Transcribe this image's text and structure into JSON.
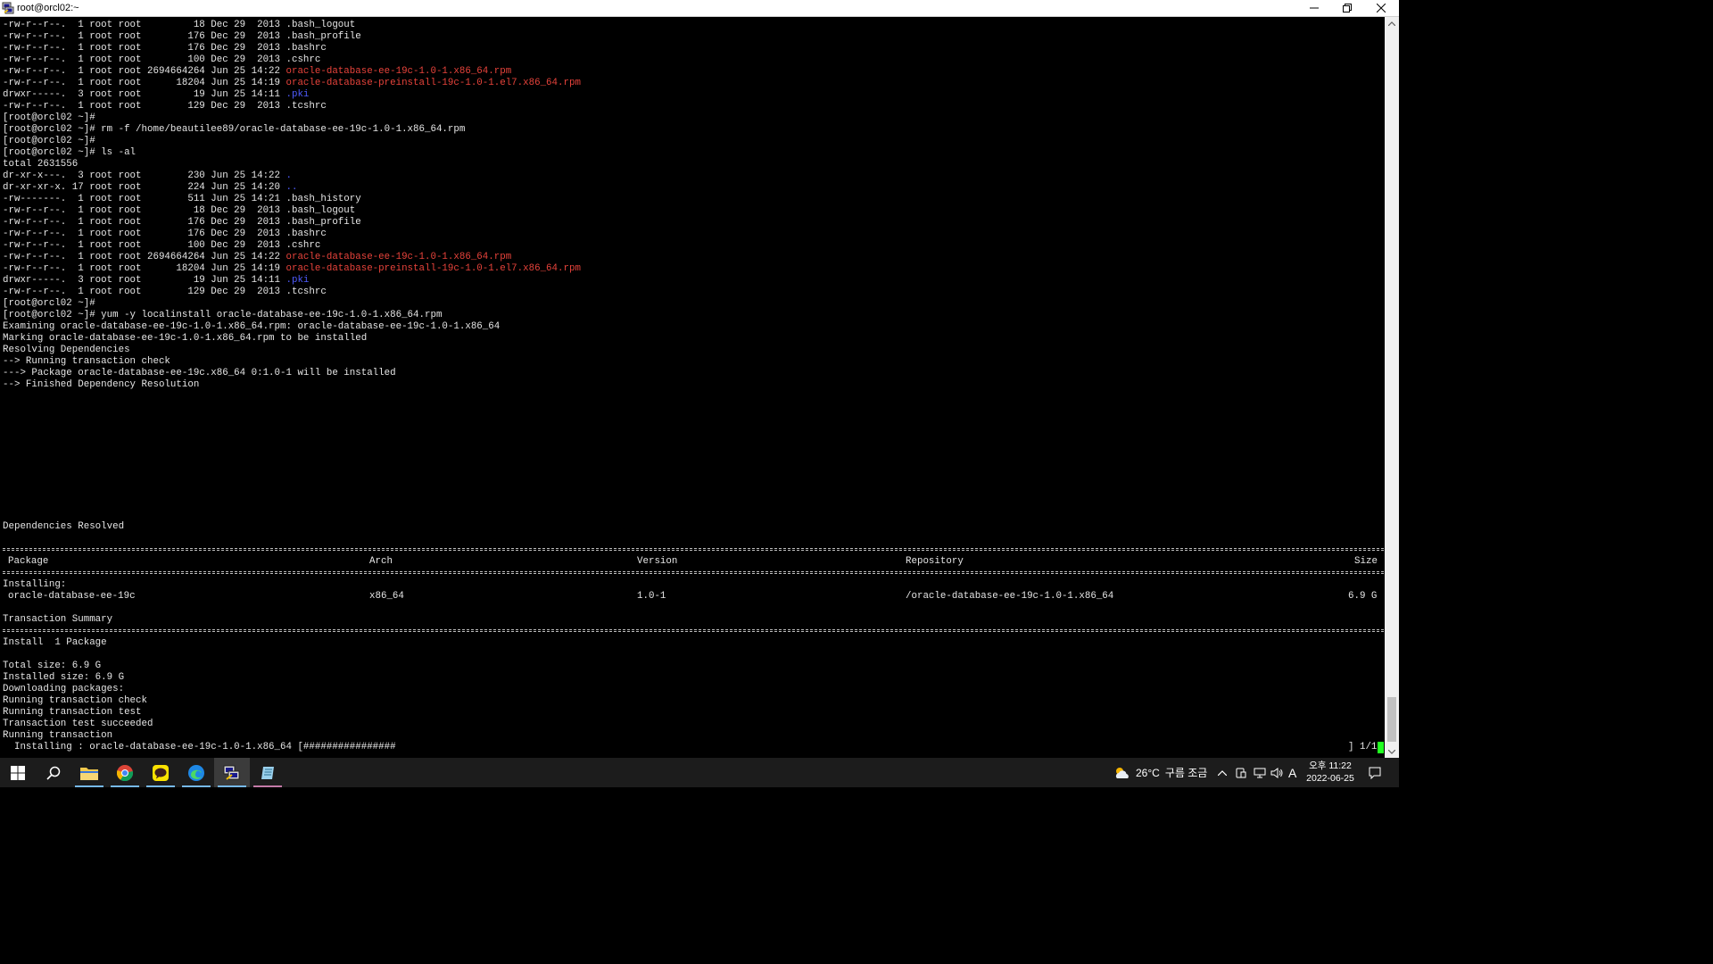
{
  "window": {
    "title": "root@orcl02:~"
  },
  "terminal": {
    "lines": [
      [
        {
          "t": "-rw-r--r--.  1 root root         18 Dec 29  2013 .bash_logout"
        }
      ],
      [
        {
          "t": "-rw-r--r--.  1 root root        176 Dec 29  2013 .bash_profile"
        }
      ],
      [
        {
          "t": "-rw-r--r--.  1 root root        176 Dec 29  2013 .bashrc"
        }
      ],
      [
        {
          "t": "-rw-r--r--.  1 root root        100 Dec 29  2013 .cshrc"
        }
      ],
      [
        {
          "t": "-rw-r--r--.  1 root root 2694664264 Jun 25 14:22 "
        },
        {
          "t": "oracle-database-ee-19c-1.0-1.x86_64.rpm",
          "c": "red"
        }
      ],
      [
        {
          "t": "-rw-r--r--.  1 root root      18204 Jun 25 14:19 "
        },
        {
          "t": "oracle-database-preinstall-19c-1.0-1.el7.x86_64.rpm",
          "c": "red"
        }
      ],
      [
        {
          "t": "drwxr-----.  3 root root         19 Jun 25 14:11 "
        },
        {
          "t": ".pki",
          "c": "blue"
        }
      ],
      [
        {
          "t": "-rw-r--r--.  1 root root        129 Dec 29  2013 .tcshrc"
        }
      ],
      [
        {
          "t": "[root@orcl02 ~]#"
        }
      ],
      [
        {
          "t": "[root@orcl02 ~]# rm -f /home/beautilee89/oracle-database-ee-19c-1.0-1.x86_64.rpm"
        }
      ],
      [
        {
          "t": "[root@orcl02 ~]#"
        }
      ],
      [
        {
          "t": "[root@orcl02 ~]# ls -al"
        }
      ],
      [
        {
          "t": "total 2631556"
        }
      ],
      [
        {
          "t": "dr-xr-x---.  3 root root        230 Jun 25 14:22 "
        },
        {
          "t": ".",
          "c": "blue"
        }
      ],
      [
        {
          "t": "dr-xr-xr-x. 17 root root        224 Jun 25 14:20 "
        },
        {
          "t": "..",
          "c": "blue"
        }
      ],
      [
        {
          "t": "-rw-------.  1 root root        511 Jun 25 14:21 .bash_history"
        }
      ],
      [
        {
          "t": "-rw-r--r--.  1 root root         18 Dec 29  2013 .bash_logout"
        }
      ],
      [
        {
          "t": "-rw-r--r--.  1 root root        176 Dec 29  2013 .bash_profile"
        }
      ],
      [
        {
          "t": "-rw-r--r--.  1 root root        176 Dec 29  2013 .bashrc"
        }
      ],
      [
        {
          "t": "-rw-r--r--.  1 root root        100 Dec 29  2013 .cshrc"
        }
      ],
      [
        {
          "t": "-rw-r--r--.  1 root root 2694664264 Jun 25 14:22 "
        },
        {
          "t": "oracle-database-ee-19c-1.0-1.x86_64.rpm",
          "c": "red"
        }
      ],
      [
        {
          "t": "-rw-r--r--.  1 root root      18204 Jun 25 14:19 "
        },
        {
          "t": "oracle-database-preinstall-19c-1.0-1.el7.x86_64.rpm",
          "c": "red"
        }
      ],
      [
        {
          "t": "drwxr-----.  3 root root         19 Jun 25 14:11 "
        },
        {
          "t": ".pki",
          "c": "blue"
        }
      ],
      [
        {
          "t": "-rw-r--r--.  1 root root        129 Dec 29  2013 .tcshrc"
        }
      ],
      [
        {
          "t": "[root@orcl02 ~]#"
        }
      ],
      [
        {
          "t": "[root@orcl02 ~]# yum -y localinstall oracle-database-ee-19c-1.0-1.x86_64.rpm"
        }
      ],
      [
        {
          "t": "Examining oracle-database-ee-19c-1.0-1.x86_64.rpm: oracle-database-ee-19c-1.0-1.x86_64"
        }
      ],
      [
        {
          "t": "Marking oracle-database-ee-19c-1.0-1.x86_64.rpm to be installed"
        }
      ],
      [
        {
          "t": "Resolving Dependencies"
        }
      ],
      [
        {
          "t": "--> Running transaction check"
        }
      ],
      [
        {
          "t": "---> Package oracle-database-ee-19c.x86_64 0:1.0-1 will be installed"
        }
      ],
      [
        {
          "t": "--> Finished Dependency Resolution"
        }
      ]
    ],
    "deps_resolved": "Dependencies Resolved",
    "table": {
      "headers": {
        "package": "Package",
        "arch": "Arch",
        "version": "Version",
        "repository": "Repository",
        "size": "Size"
      },
      "installing_label": "Installing:",
      "row": {
        "package": "oracle-database-ee-19c",
        "arch": "x86_64",
        "version": "1.0-1",
        "repository": "/oracle-database-ee-19c-1.0-1.x86_64",
        "size": "6.9 G"
      }
    },
    "transaction_summary": "Transaction Summary",
    "install_line": "Install  1 Package",
    "tail_lines": [
      "Total size: 6.9 G",
      "Installed size: 6.9 G",
      "Downloading packages:",
      "Running transaction check",
      "Running transaction test",
      "Transaction test succeeded",
      "Running transaction"
    ],
    "progress": {
      "left": "  Installing : oracle-database-ee-19c-1.0-1.x86_64 [################",
      "right": "] 1/1"
    }
  },
  "taskbar": {
    "weather_temp": "26°C",
    "weather_desc": "구름 조금",
    "ime_label": "A",
    "clock_time": "오후 11:22",
    "clock_date": "2022-06-25"
  }
}
